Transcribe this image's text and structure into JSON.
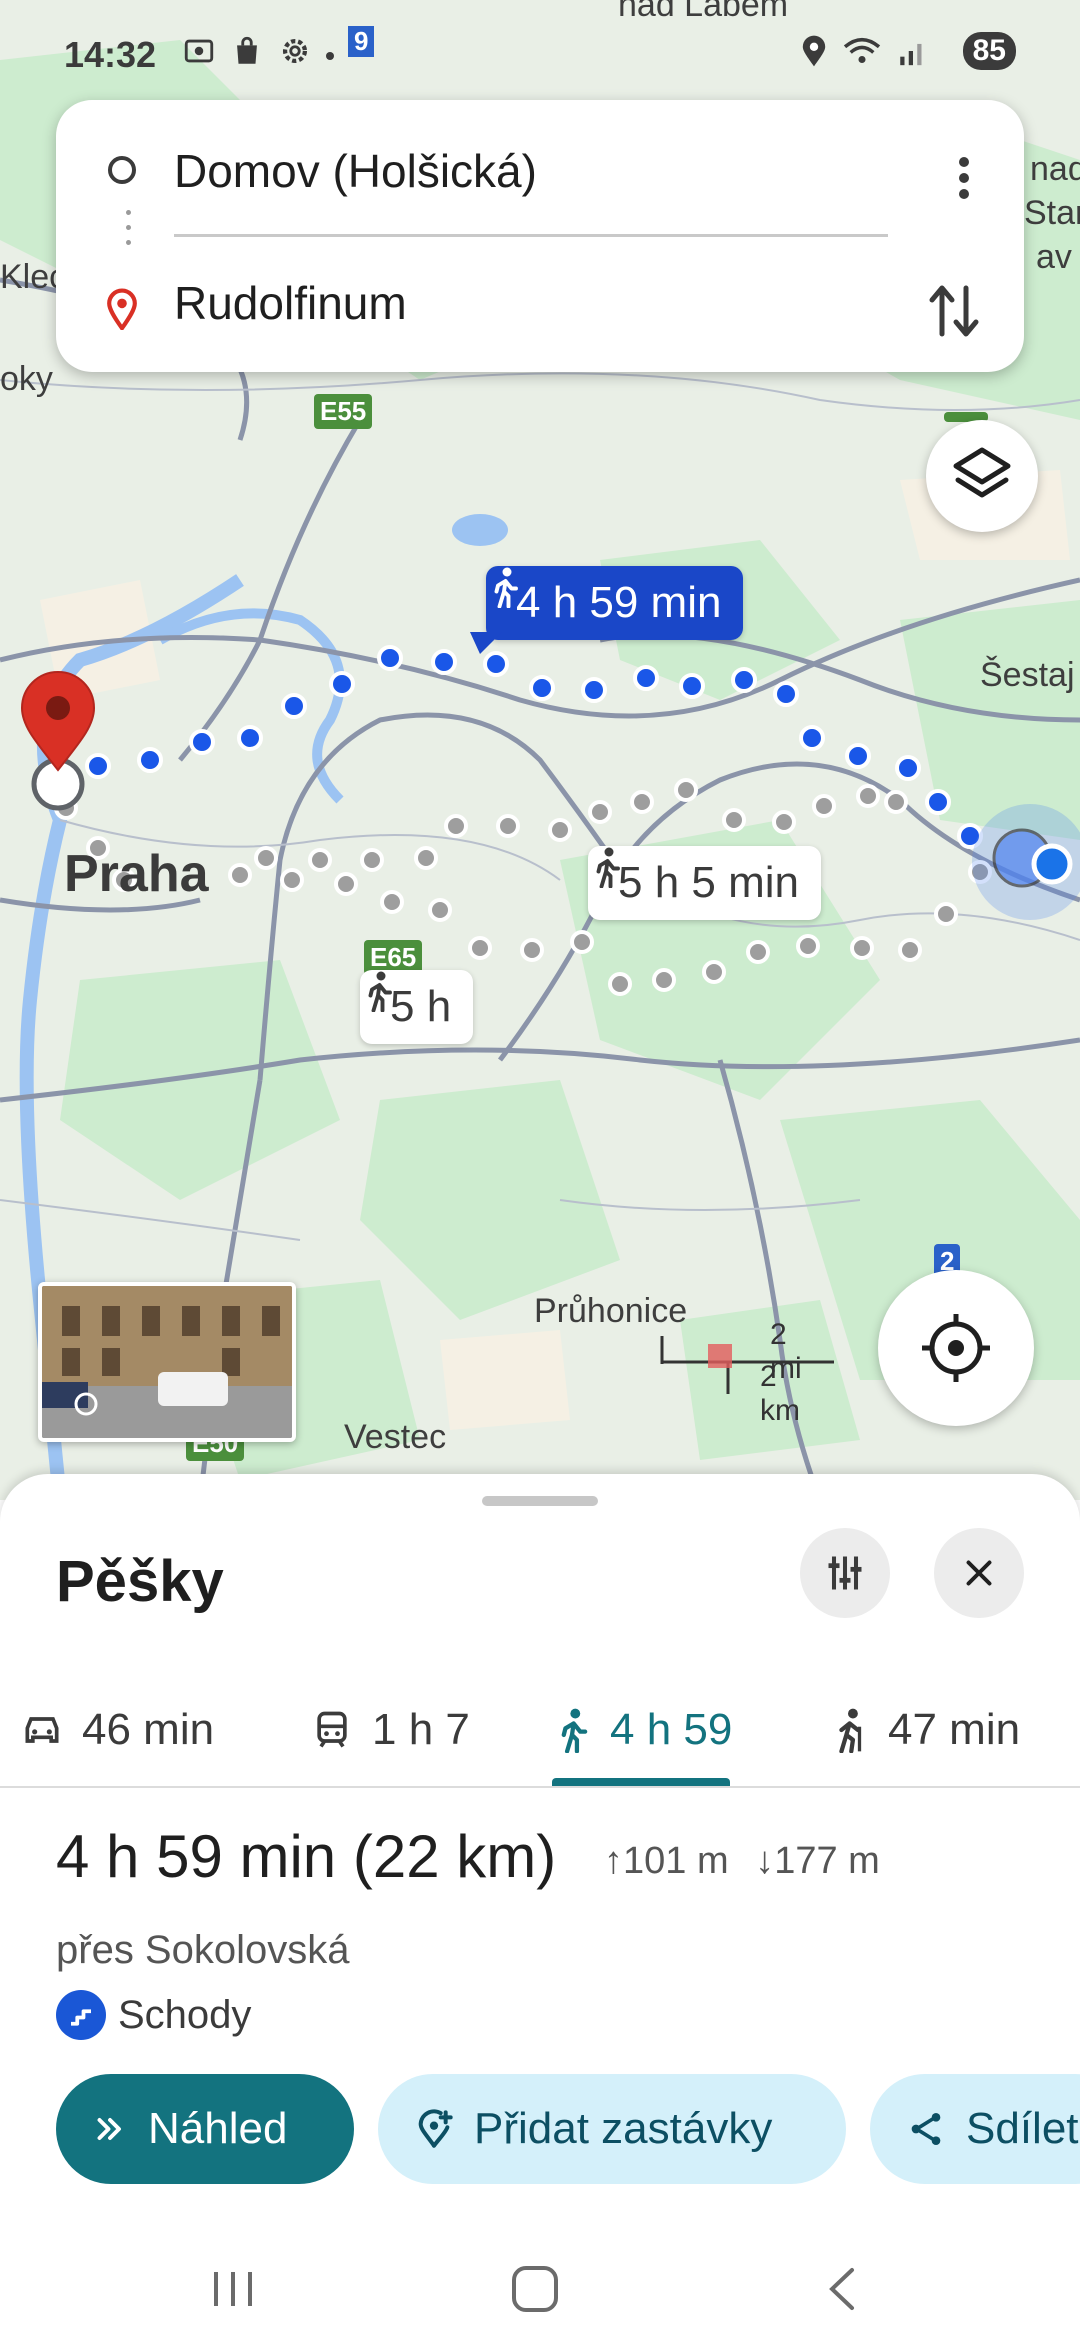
{
  "status_bar": {
    "time": "14:32",
    "notification_badge": "9",
    "battery": "85",
    "icons": [
      "screenshot-icon",
      "bag-icon",
      "settings-icon",
      "location-icon",
      "wifi-icon",
      "signal-icon"
    ]
  },
  "search": {
    "origin": "Domov (Holšická)",
    "destination": "Rudolfinum"
  },
  "map": {
    "route_labels": {
      "selected": "4 h 59 min",
      "alt1": "5 h 5 min",
      "alt2": "5 h"
    },
    "places": {
      "city": "Praha",
      "pruhonice": "Průhonice",
      "vestec": "Vestec",
      "sestajovice": "Šestaj",
      "kleci": "Klec",
      "oky": "oky",
      "top_right": "nad",
      "top_right2": "Stara",
      "top_right3": "av",
      "top_center": "nad Labem"
    },
    "shields": {
      "e55": "E55",
      "e65": "E65",
      "e50": "E50",
      "two": "2"
    },
    "scale": {
      "mi": "2 mi",
      "km": "2 km"
    },
    "colors": {
      "selected_route": "#1a47c8",
      "alt_route": "#9e9e9e",
      "destination_pin": "#d93025"
    }
  },
  "sheet": {
    "title": "Pěšky",
    "tabs": [
      {
        "label": "46 min",
        "icon": "car-icon"
      },
      {
        "label": "1 h 7",
        "icon": "transit-icon"
      },
      {
        "label": "4 h 59",
        "icon": "walk-icon"
      },
      {
        "label": "47 min",
        "icon": "scooter-icon"
      }
    ],
    "active_tab": 2,
    "summary": {
      "duration": "4 h 59 min",
      "distance": "(22 km)",
      "ascent": "101 m",
      "descent": "177 m",
      "via": "přes Sokolovská",
      "warning": "Schody"
    },
    "actions": {
      "preview": "Náhled",
      "add_stops": "Přidat zastávky",
      "share": "Sdílet"
    }
  }
}
